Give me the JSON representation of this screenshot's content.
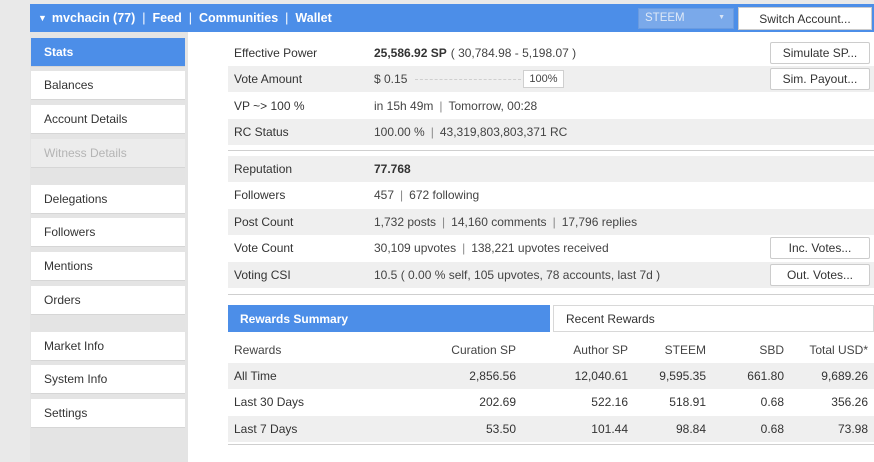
{
  "topbar": {
    "account": "mvchacin (77)",
    "nav": [
      "Feed",
      "Communities",
      "Wallet"
    ],
    "currency": "STEEM",
    "switch_account": "Switch Account..."
  },
  "sidebar": {
    "items": [
      {
        "label": "Stats",
        "state": "active"
      },
      {
        "label": "Balances"
      },
      {
        "label": "Account Details"
      },
      {
        "label": "Witness Details",
        "state": "disabled"
      },
      {
        "label": "Delegations"
      },
      {
        "label": "Followers"
      },
      {
        "label": "Mentions"
      },
      {
        "label": "Orders"
      },
      {
        "label": "Market Info"
      },
      {
        "label": "System Info"
      },
      {
        "label": "Settings"
      }
    ]
  },
  "stats": {
    "effective_power": {
      "label": "Effective Power",
      "value": "25,586.92 SP",
      "detail": "( 30,784.98 - 5,198.07 )",
      "button": "Simulate SP..."
    },
    "vote_amount": {
      "label": "Vote Amount",
      "value": "$ 0.15",
      "percent": "100%",
      "percent_value": 1.0,
      "button": "Sim. Payout..."
    },
    "vp": {
      "label": "VP ~> 100 %",
      "value": "in 15h 49m",
      "detail": "Tomorrow, 00:28"
    },
    "rc_status": {
      "label": "RC Status",
      "value": "100.00 %",
      "detail": "43,319,803,803,371 RC"
    },
    "reputation": {
      "label": "Reputation",
      "value": "77.768"
    },
    "followers": {
      "label": "Followers",
      "value": "457",
      "detail": "672 following"
    },
    "post_count": {
      "label": "Post Count",
      "value": "1,732 posts",
      "detail": "14,160 comments",
      "detail2": "17,796 replies"
    },
    "vote_count": {
      "label": "Vote Count",
      "value": "30,109 upvotes",
      "detail": "138,221 upvotes received",
      "button": "Inc. Votes..."
    },
    "voting_csi": {
      "label": "Voting CSI",
      "value": "10.5 ( 0.00 % self, 105 upvotes, 78 accounts, last 7d )",
      "button": "Out. Votes..."
    }
  },
  "tabs": {
    "rewards_summary": "Rewards Summary",
    "recent_rewards": "Recent Rewards"
  },
  "rewards_table": {
    "headers": [
      "Rewards",
      "Curation SP",
      "Author SP",
      "STEEM",
      "SBD",
      "Total USD*"
    ],
    "rows": [
      [
        "All Time",
        "2,856.56",
        "12,040.61",
        "9,595.35",
        "661.80",
        "9,689.26"
      ],
      [
        "Last 30 Days",
        "202.69",
        "522.16",
        "518.91",
        "0.68",
        "356.26"
      ],
      [
        "Last 7 Days",
        "53.50",
        "101.44",
        "98.84",
        "0.68",
        "73.98"
      ]
    ]
  }
}
